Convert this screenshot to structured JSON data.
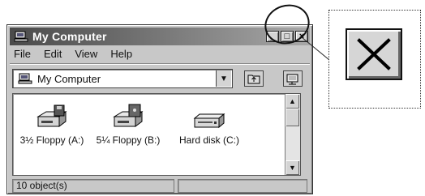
{
  "window": {
    "title": "My Computer",
    "controls": {
      "minimize": "_",
      "maximize": "□",
      "close": "×"
    }
  },
  "menu": [
    "File",
    "Edit",
    "View",
    "Help"
  ],
  "address": {
    "value": "My Computer",
    "dropdown_glyph": "▼"
  },
  "toolbar": {
    "up_glyph": "⤴",
    "map_glyph": "⧉"
  },
  "items": [
    {
      "label": "3½ Floppy (A:)",
      "icon": "floppy-drive-icon"
    },
    {
      "label": "5¼ Floppy (B:)",
      "icon": "floppy-drive-icon"
    },
    {
      "label": "Hard disk (C:)",
      "icon": "hard-disk-icon"
    }
  ],
  "status": {
    "objects": "10 object(s)",
    "second": ""
  },
  "zoom": {
    "close_glyph": "×"
  }
}
